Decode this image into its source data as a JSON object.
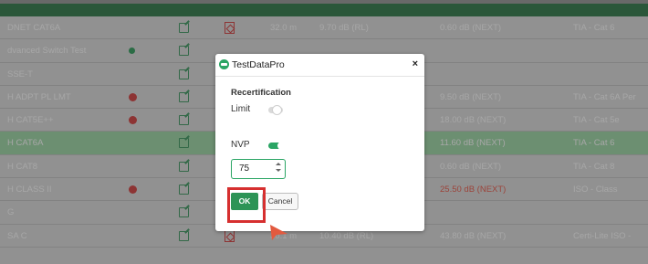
{
  "table": {
    "rows": [
      {
        "name": "DNET CAT6A",
        "status": "pass",
        "has_report": true,
        "length": "32.0 m",
        "worst_margin": "9.70 dB (RL)",
        "worst_margin2": "0.60 dB (NEXT)",
        "limit": "TIA - Cat 6",
        "highlight": false
      },
      {
        "name": "dvanced Switch Test",
        "status": "warn",
        "has_report": false,
        "length": "",
        "worst_margin": "",
        "worst_margin2": "",
        "limit": "",
        "highlight": false
      },
      {
        "name": "SSE-T",
        "status": "pass",
        "has_report": false,
        "length": "",
        "worst_margin": "",
        "worst_margin2": "",
        "limit": "",
        "highlight": false
      },
      {
        "name": "H ADPT PL LMT",
        "status": "fail",
        "has_report": false,
        "length": "",
        "worst_margin": "",
        "worst_margin2": "9.50 dB (NEXT)",
        "limit": "TIA - Cat 6A Per",
        "highlight": false
      },
      {
        "name": "H CAT5E++",
        "status": "fail",
        "has_report": false,
        "length": "",
        "worst_margin": "",
        "worst_margin2": "18.00 dB (NEXT)",
        "limit": "TIA - Cat 5e",
        "highlight": false
      },
      {
        "name": "H CAT6A",
        "status": "pass",
        "has_report": false,
        "length": "",
        "worst_margin": "",
        "worst_margin2": "11.60 dB (NEXT)",
        "limit": "TIA - Cat 6",
        "highlight": true
      },
      {
        "name": "H CAT8",
        "status": "pass",
        "has_report": false,
        "length": "",
        "worst_margin": "",
        "worst_margin2": "0.60 dB (NEXT)",
        "limit": "TIA - Cat 8",
        "highlight": false
      },
      {
        "name": "H CLASS II",
        "status": "fail",
        "has_report": false,
        "length": "",
        "worst_margin": "",
        "worst_margin2": "25.50 dB (NEXT)",
        "limit": "ISO - Class",
        "highlight": false
      },
      {
        "name": "G",
        "status": "pass",
        "has_report": false,
        "length": "",
        "worst_margin": "",
        "worst_margin2": "",
        "limit": "",
        "highlight": false
      },
      {
        "name": "SA C",
        "status": "pass",
        "has_report": true,
        "length": "30.1 m",
        "worst_margin": "10.40 dB (RL)",
        "worst_margin2": "43.80 dB (NEXT)",
        "limit": "Certi-Lite ISO - ",
        "highlight": false
      }
    ]
  },
  "modal": {
    "title": "TestDataPro",
    "close_label": "×",
    "section_title": "Recertification",
    "limit_label": "Limit",
    "limit_on": false,
    "nvp_label": "NVP",
    "nvp_on": true,
    "nvp_value": "75",
    "ok_label": "OK",
    "cancel_label": "Cancel"
  },
  "colors": {
    "accent": "#2aa564",
    "fail": "#c8302f",
    "highlight": "#d62f2f",
    "cursor": "#e25a3f"
  }
}
